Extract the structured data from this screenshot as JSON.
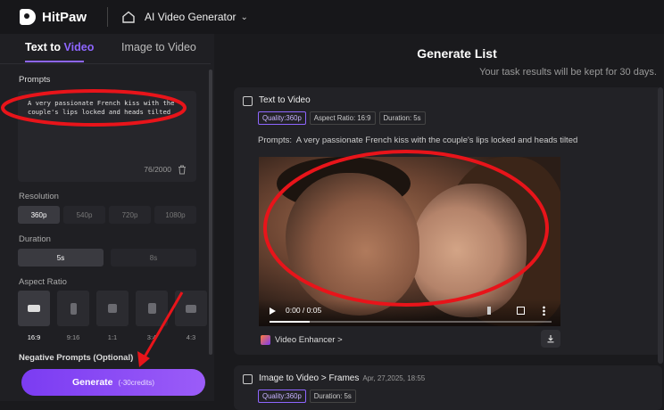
{
  "topbar": {
    "brand": "HitPaw",
    "nav_title": "AI Video Generator"
  },
  "left": {
    "tabs": [
      "Text to Video",
      "Image to Video"
    ],
    "tab_active_prefix": "Text to ",
    "tab_active_accent": "Video",
    "prompts_label": "Prompts",
    "prompt_text": "A very passionate French kiss with the couple's lips locked and heads tilted",
    "char_count": "76/2000",
    "resolution_label": "Resolution",
    "resolutions": [
      "360p",
      "540p",
      "720p",
      "1080p"
    ],
    "duration_label": "Duration",
    "durations": [
      "5s",
      "8s"
    ],
    "aspect_label": "Aspect Ratio",
    "aspects": [
      "16:9",
      "9:16",
      "1:1",
      "3:4",
      "4:3"
    ],
    "negative_label": "Negative Prompts (Optional)",
    "generate_label": "Generate",
    "generate_credits": "(-30credits)"
  },
  "right": {
    "title": "Generate List",
    "subtitle": "Your task results will be kept for 30 days.",
    "card1": {
      "title": "Text to Video",
      "tags": [
        "Quality:360p",
        "Aspect Ratio: 16:9",
        "Duration: 5s"
      ],
      "prompt_prefix": "Prompts:",
      "prompt": "A very passionate French kiss with the couple's lips locked and heads tilted",
      "time": "0:00 / 0:05",
      "enhancer": "Video Enhancer >"
    },
    "card2": {
      "title": "Image to Video > Frames",
      "date": "Apr, 27,2025, 18:55",
      "tags": [
        "Quality:360p",
        "Duration: 5s"
      ]
    }
  },
  "colors": {
    "accent": "#8e66ff",
    "annotation": "#e8141a"
  }
}
